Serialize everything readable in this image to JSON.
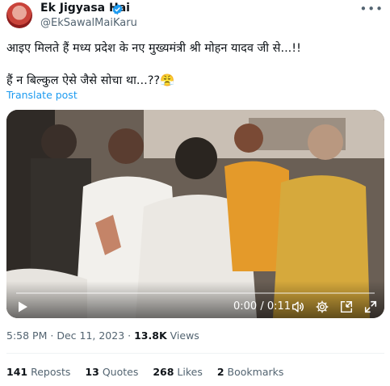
{
  "author": {
    "display_name": "Ek Jigyasa Hai",
    "handle": "@EkSawalMaiKaru",
    "verified_icon": "verified-badge-icon",
    "accent": "#1d9bf0"
  },
  "more_icon": "more-icon",
  "tweet": {
    "text": "आइए मिलते हैं मध्य प्रदेश के नए मुख्यमंत्री श्री मोहन यादव जी से...!!\n\nहैं न बिल्कुल ऐसे जैसे सोचा था...??😤",
    "translate_label": "Translate post"
  },
  "video": {
    "time": "0:00 / 0:11",
    "progress": 0,
    "play_icon": "play-icon",
    "volume_icon": "volume-icon",
    "settings_icon": "settings-icon",
    "pip_icon": "picture-in-picture-icon",
    "fullscreen_icon": "fullscreen-icon"
  },
  "meta": {
    "time": "5:58 PM",
    "separator": "·",
    "date": "Dec 11, 2023",
    "views_count": "13.8K",
    "views_label": "Views"
  },
  "stats": {
    "reposts_count": "141",
    "reposts_label": "Reposts",
    "quotes_count": "13",
    "quotes_label": "Quotes",
    "likes_count": "268",
    "likes_label": "Likes",
    "bookmarks_count": "2",
    "bookmarks_label": "Bookmarks"
  }
}
